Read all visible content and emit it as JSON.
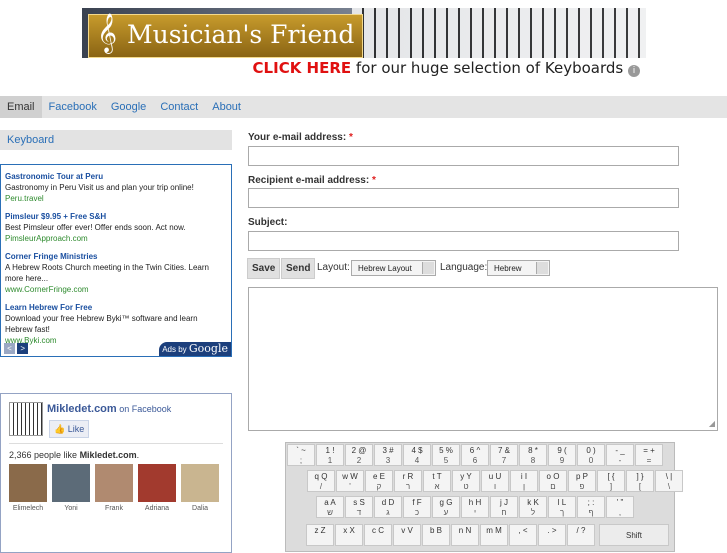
{
  "banner": {
    "logo_text": "Musician's Friend",
    "cta_strong": "CLICK HERE",
    "cta_rest": " for our huge selection of Keyboards",
    "info": "i"
  },
  "nav": {
    "items": [
      "Email",
      "Facebook",
      "Google",
      "Contact",
      "About"
    ],
    "active": "Email"
  },
  "sidebar": {
    "tab": "Keyboard",
    "ads": [
      {
        "title": "Gastronomic Tour at Peru",
        "desc": "Gastronomy in Peru Visit us and plan your trip online!",
        "url": "Peru.travel"
      },
      {
        "title": "Pimsleur $9.95 + Free S&H",
        "desc": "Best Pimsleur offer ever! Offer ends soon. Act now.",
        "url": "PimsleurApproach.com"
      },
      {
        "title": "Corner Fringe Ministries",
        "desc": "A Hebrew Roots Church meeting in the Twin Cities. Learn more here...",
        "url": "www.CornerFringe.com"
      },
      {
        "title": "Learn Hebrew For Free",
        "desc": "Download your free Hebrew Byki™ software and learn Hebrew fast!",
        "url": "www.Byki.com"
      }
    ],
    "ads_by_prefix": "Ads by",
    "ads_by_brand": "Google",
    "prev_arrow": "<",
    "next_arrow": ">"
  },
  "facebook": {
    "page_name": "Mikledet.com",
    "on_text": " on Facebook",
    "like_label": "Like",
    "count_prefix": "2,366 people like ",
    "count_page": "Mikledet.com",
    "count_suffix": ".",
    "faces": [
      {
        "name": "Elimelech",
        "color": "#8a6a4a"
      },
      {
        "name": "Yoni",
        "color": "#5c6b78"
      },
      {
        "name": "Frank",
        "color": "#b08a70"
      },
      {
        "name": "Adriana",
        "color": "#a23a2e"
      },
      {
        "name": "Dalia",
        "color": "#c9b590"
      }
    ]
  },
  "form": {
    "from_label": "Your e-mail address:",
    "to_label": "Recipient e-mail address:",
    "subject_label": "Subject:",
    "required_mark": "*",
    "save_label": "Save",
    "send_label": "Send",
    "layout_label": "Layout:",
    "layout_value": "Hebrew Layout",
    "language_label": "Language:",
    "language_value": "Hebrew",
    "resize_grip": "◢"
  },
  "keyboard": {
    "row1": [
      [
        "` ~",
        "; "
      ],
      [
        "1 !",
        "1"
      ],
      [
        "2 @",
        "2"
      ],
      [
        "3 #",
        "3"
      ],
      [
        "4 $",
        "4"
      ],
      [
        "5 %",
        "5"
      ],
      [
        "6 ^",
        "6"
      ],
      [
        "7 &",
        "7"
      ],
      [
        "8 *",
        "8"
      ],
      [
        "9 (",
        "9"
      ],
      [
        "0 )",
        "0"
      ],
      [
        "- _",
        "-"
      ],
      [
        "= +",
        "="
      ]
    ],
    "row2": [
      [
        "q Q",
        "/"
      ],
      [
        "w W",
        "'"
      ],
      [
        "e E",
        "ק"
      ],
      [
        "r R",
        "ר"
      ],
      [
        "t T",
        "א"
      ],
      [
        "y Y",
        "ט"
      ],
      [
        "u U",
        "ו"
      ],
      [
        "i I",
        "ן"
      ],
      [
        "o O",
        "ם"
      ],
      [
        "p P",
        "פ"
      ],
      [
        "[ {",
        "]"
      ],
      [
        "] }",
        "["
      ],
      [
        "\\ |",
        "\\"
      ]
    ],
    "row3": [
      [
        "a A",
        "ש"
      ],
      [
        "s S",
        "ד"
      ],
      [
        "d D",
        "ג"
      ],
      [
        "f F",
        "כ"
      ],
      [
        "g G",
        "ע"
      ],
      [
        "h H",
        "י"
      ],
      [
        "j J",
        "ח"
      ],
      [
        "k K",
        "ל"
      ],
      [
        "l L",
        "ך"
      ],
      [
        "; :",
        "ף"
      ],
      [
        "' \"",
        ","
      ]
    ],
    "row4": [
      [
        "z Z",
        ""
      ],
      [
        "x X",
        ""
      ],
      [
        "c C",
        ""
      ],
      [
        "v V",
        ""
      ],
      [
        "b B",
        ""
      ],
      [
        "n N",
        ""
      ],
      [
        "m M",
        ""
      ],
      [
        ", <",
        ""
      ],
      [
        ". >",
        ""
      ],
      [
        "/ ?",
        ""
      ]
    ],
    "shift_label": "Shift"
  }
}
